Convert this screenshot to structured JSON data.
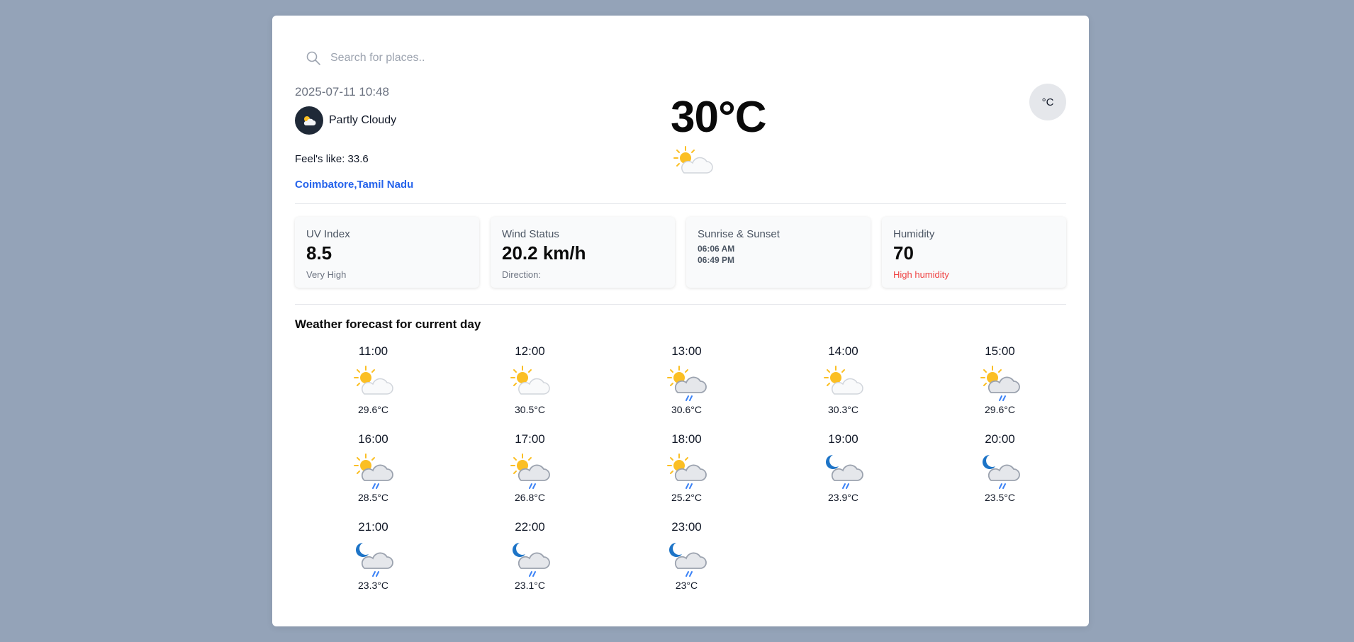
{
  "search": {
    "placeholder": "Search for places.."
  },
  "current": {
    "datetime": "2025-07-11 10:48",
    "condition": "Partly Cloudy",
    "feels_like": "Feel's like: 33.6",
    "location": "Coimbatore,Tamil Nadu",
    "temperature": "30°C",
    "icon": "sun-cloud-icon"
  },
  "unit_toggle": {
    "label": "°C"
  },
  "stats": {
    "uv": {
      "title": "UV Index",
      "value": "8.5",
      "sub": "Very High"
    },
    "wind": {
      "title": "Wind Status",
      "value": "20.2 km/h",
      "sub": "Direction:"
    },
    "sun": {
      "title": "Sunrise & Sunset",
      "sunrise": "06:06 AM",
      "sunset": "06:49 PM"
    },
    "humidity": {
      "title": "Humidity",
      "value": "70",
      "sub": "High humidity",
      "sub_color": "#ef4444"
    }
  },
  "forecast": {
    "title": "Weather forecast for current day",
    "hours": [
      {
        "time": "11:00",
        "temp": "29.6°C",
        "icon": "sun-cloud"
      },
      {
        "time": "12:00",
        "temp": "30.5°C",
        "icon": "sun-cloud"
      },
      {
        "time": "13:00",
        "temp": "30.6°C",
        "icon": "sun-rain"
      },
      {
        "time": "14:00",
        "temp": "30.3°C",
        "icon": "sun-cloud"
      },
      {
        "time": "15:00",
        "temp": "29.6°C",
        "icon": "sun-rain"
      },
      {
        "time": "16:00",
        "temp": "28.5°C",
        "icon": "sun-rain"
      },
      {
        "time": "17:00",
        "temp": "26.8°C",
        "icon": "sun-rain"
      },
      {
        "time": "18:00",
        "temp": "25.2°C",
        "icon": "sun-rain"
      },
      {
        "time": "19:00",
        "temp": "23.9°C",
        "icon": "moon-rain"
      },
      {
        "time": "20:00",
        "temp": "23.5°C",
        "icon": "moon-rain"
      },
      {
        "time": "21:00",
        "temp": "23.3°C",
        "icon": "moon-rain"
      },
      {
        "time": "22:00",
        "temp": "23.1°C",
        "icon": "moon-rain"
      },
      {
        "time": "23:00",
        "temp": "23°C",
        "icon": "moon-rain"
      }
    ]
  },
  "colors": {
    "page_bg": "#94a3b8",
    "accent_link": "#2563eb",
    "sun": "#fbbf24",
    "moon": "#1d74c7",
    "rain": "#3b82f6"
  }
}
